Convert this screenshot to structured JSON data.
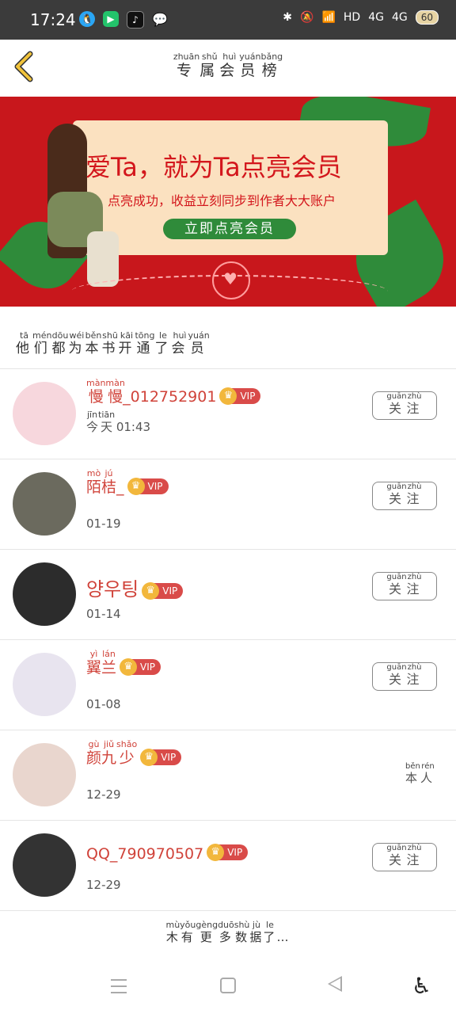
{
  "status_bar": {
    "time": "17:24",
    "network": "HD",
    "signal1": "4G",
    "signal2": "4G",
    "battery": "60"
  },
  "header": {
    "title_chars": [
      "专",
      "属",
      "会",
      "员",
      "榜"
    ],
    "title_pinyin": [
      "zhuān",
      "shǔ",
      "huì",
      "yuán",
      "bǎng"
    ]
  },
  "banner": {
    "headline": "爱Ta，就为Ta点亮会员",
    "subtitle": "点亮成功，收益立刻同步到作者大大账户",
    "button": "立即点亮会员"
  },
  "section": {
    "chars": [
      "他",
      "们",
      "都",
      "为",
      "本",
      "书",
      "开",
      "通",
      "了",
      "会",
      "员"
    ],
    "pinyin": [
      "tā",
      "mén",
      "dōu",
      "wéi",
      "běn",
      "shū",
      "kāi",
      "tōng",
      "le",
      "huì",
      "yuán"
    ]
  },
  "members": [
    {
      "name": "慢慢_012752901",
      "name_ruby": [
        [
          "慢",
          "màn"
        ],
        [
          "慢",
          "màn"
        ]
      ],
      "name_rest": "_012752901",
      "vip": "VIP",
      "date": "01:43",
      "date_ruby": [
        [
          "今",
          "jīn"
        ],
        [
          "天",
          "tiān"
        ]
      ],
      "action": "关注",
      "action_pinyin": [
        "guān",
        "zhù"
      ]
    },
    {
      "name": "陌桔_",
      "name_ruby": [
        [
          "陌",
          "mò"
        ],
        [
          "桔",
          "jú"
        ]
      ],
      "name_rest": "_",
      "vip": "VIP",
      "date": "01-19",
      "action": "关注",
      "action_pinyin": [
        "guān",
        "zhù"
      ]
    },
    {
      "name": "양우팅",
      "name_plain": "양우팅",
      "vip": "VIP",
      "date": "01-14",
      "action": "关注",
      "action_pinyin": [
        "guān",
        "zhù"
      ]
    },
    {
      "name": "翼兰",
      "name_ruby": [
        [
          "翼",
          "yì"
        ],
        [
          "兰",
          "lán"
        ]
      ],
      "name_rest": "",
      "vip": "VIP",
      "date": "01-08",
      "action": "关注",
      "action_pinyin": [
        "guān",
        "zhù"
      ]
    },
    {
      "name": "颜九少",
      "name_ruby": [
        [
          "颜",
          "gù"
        ],
        [
          "九",
          "jiǔ"
        ],
        [
          "少",
          "shǎo"
        ]
      ],
      "name_rest": "",
      "vip": "VIP",
      "date": "12-29",
      "action": "本人",
      "action_pinyin": [
        "běn",
        "rén"
      ]
    },
    {
      "name": "QQ_790970507",
      "name_plain": "QQ_790970507",
      "vip": "VIP",
      "date": "12-29",
      "action": "关注",
      "action_pinyin": [
        "guān",
        "zhù"
      ]
    }
  ],
  "footer": {
    "chars": [
      "木",
      "有",
      "更",
      "多",
      "数",
      "据",
      "了"
    ],
    "pinyin": [
      "mù",
      "yǒu",
      "gèng",
      "duō",
      "shù",
      "jù",
      "le"
    ],
    "ellipsis": "…"
  }
}
